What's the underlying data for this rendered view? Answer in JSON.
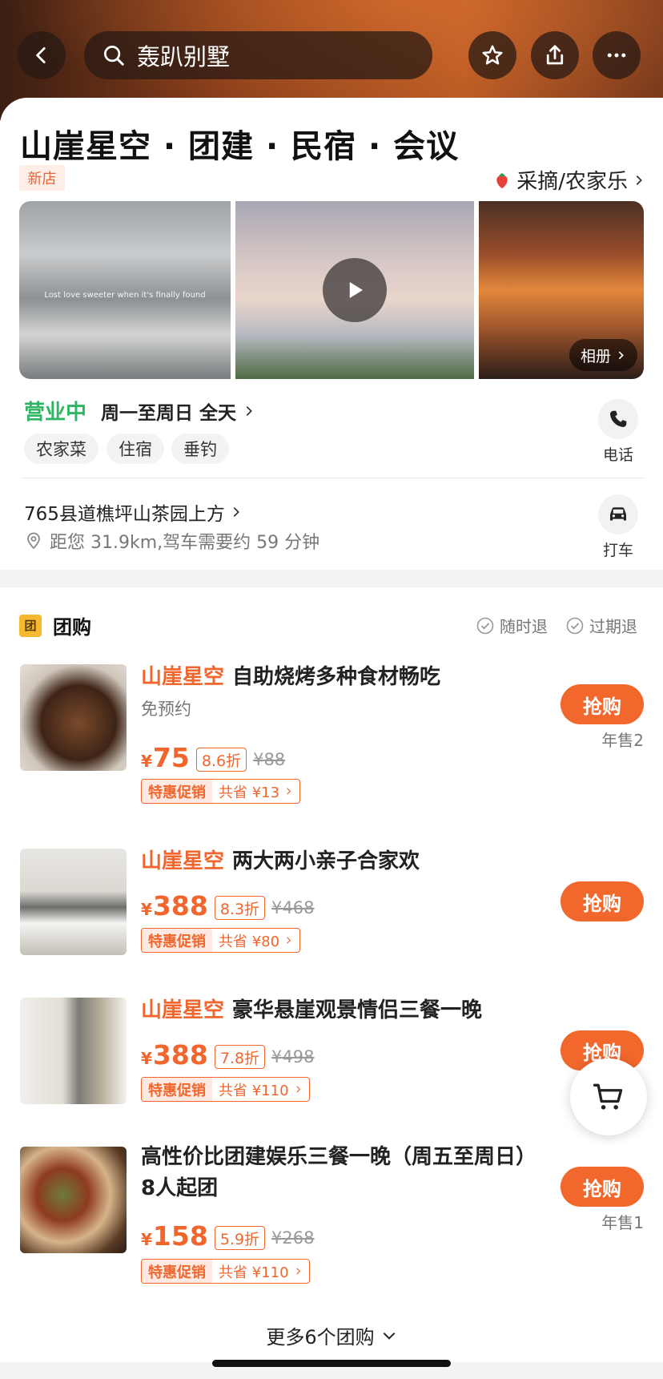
{
  "header": {
    "search_query": "轰趴别墅",
    "icons": [
      "back-icon",
      "search-icon",
      "star-icon",
      "share-icon",
      "more-icon"
    ]
  },
  "shop": {
    "title": "山崖星空 · 团建 · 民宿 · 会议",
    "new_tag": "新店",
    "category": "采摘/农家乐",
    "album_label": "相册",
    "photo_caption": "Lost love sweeter when it's finally found",
    "status": "营业中",
    "hours": "周一至周日 全天",
    "chips": [
      "农家菜",
      "住宿",
      "垂钓"
    ],
    "phone_label": "电话",
    "address": "765县道樵坪山茶园上方",
    "distance": "距您 31.9km,驾车需要约 59 分钟",
    "taxi_label": "打车"
  },
  "group": {
    "title": "团购",
    "badge": "团",
    "policy1": "随时退",
    "policy2": "过期退",
    "buy_label": "抢购",
    "promo_label": "特惠促销",
    "deals": [
      {
        "brand": "山崖星空",
        "name": "自助烧烤多种食材畅吃",
        "sub": "免预约",
        "yen": "¥",
        "price": "75",
        "discount": "8.6折",
        "orig": "¥88",
        "save": "共省 ¥13",
        "sales": "年售2"
      },
      {
        "brand": "山崖星空",
        "name": "两大两小亲子合家欢",
        "sub": "",
        "yen": "¥",
        "price": "388",
        "discount": "8.3折",
        "orig": "¥468",
        "save": "共省 ¥80",
        "sales": ""
      },
      {
        "brand": "山崖星空",
        "name": "豪华悬崖观景情侣三餐一晚",
        "sub": "",
        "yen": "¥",
        "price": "388",
        "discount": "7.8折",
        "orig": "¥498",
        "save": "共省 ¥110",
        "sales": ""
      },
      {
        "brand": "",
        "name": "高性价比团建娱乐三餐一晚（周五至周日）8人起团",
        "sub": "",
        "yen": "¥",
        "price": "158",
        "discount": "5.9折",
        "orig": "¥268",
        "save": "共省 ¥110",
        "sales": "年售1"
      }
    ],
    "more": "更多6个团购"
  },
  "colors": {
    "accent": "#f0662d",
    "open_green": "#2fb563",
    "tag_yellow": "#f6b82f"
  }
}
